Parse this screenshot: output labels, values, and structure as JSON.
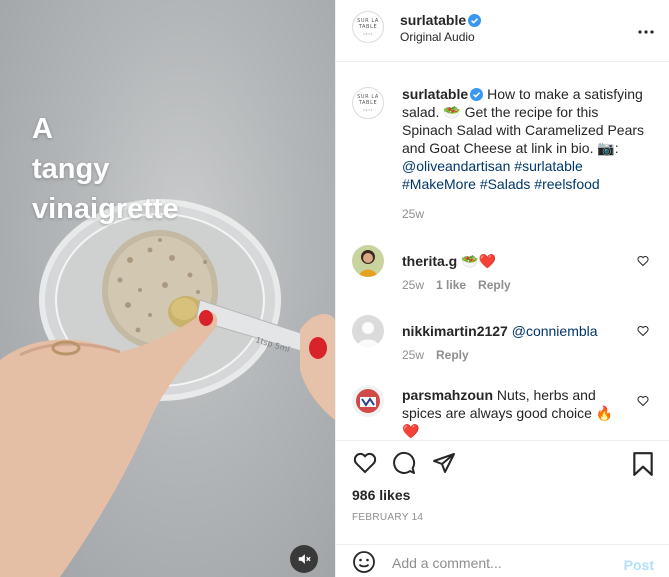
{
  "media": {
    "overlay_lines": [
      "A",
      "tangy",
      "vinaigrette"
    ],
    "mute_icon": "speaker-muted-icon",
    "spoon_label": "1tsp 5ml"
  },
  "header": {
    "username": "surlatable",
    "subtitle": "Original Audio",
    "logo_lines": [
      "SUR LA",
      "TABLE",
      "1972"
    ],
    "more_icon": "more-horizontal-icon"
  },
  "caption": {
    "username": "surlatable",
    "text_parts": {
      "intro": "How to make a satisfying salad. ",
      "salad_emoji": "🥗",
      "body": " Get the recipe for this Spinach Salad with Caramelized Pears and Goat Cheese at link in bio. ",
      "camera_emoji": "📷",
      "colon": ":",
      "mention": "@oliveandartisan",
      "tags": [
        "#surlatable",
        "#MakeMore",
        "#Salads",
        "#reelsfood"
      ]
    },
    "timestamp": "25w"
  },
  "comments": [
    {
      "username": "therita.g",
      "text": "",
      "emojis": "🥗❤️",
      "time": "25w",
      "likes": "1 like",
      "reply": "Reply"
    },
    {
      "username": "nikkimartin2127",
      "text": "@conniembla",
      "time": "25w",
      "likes": "",
      "reply": "Reply"
    },
    {
      "username": "parsmahzoun",
      "text": "Nuts, herbs and spices are always good choice ",
      "emoji1": "🔥",
      "emoji2": "❤️"
    }
  ],
  "actions": {
    "likes": "986 likes",
    "date": "FEBRUARY 14",
    "comment_placeholder": "Add a comment...",
    "post_label": "Post"
  },
  "colors": {
    "verified": "#3897f0",
    "link": "#00376b",
    "heart": "#ed4956",
    "post_disabled": "#b2dffc"
  }
}
